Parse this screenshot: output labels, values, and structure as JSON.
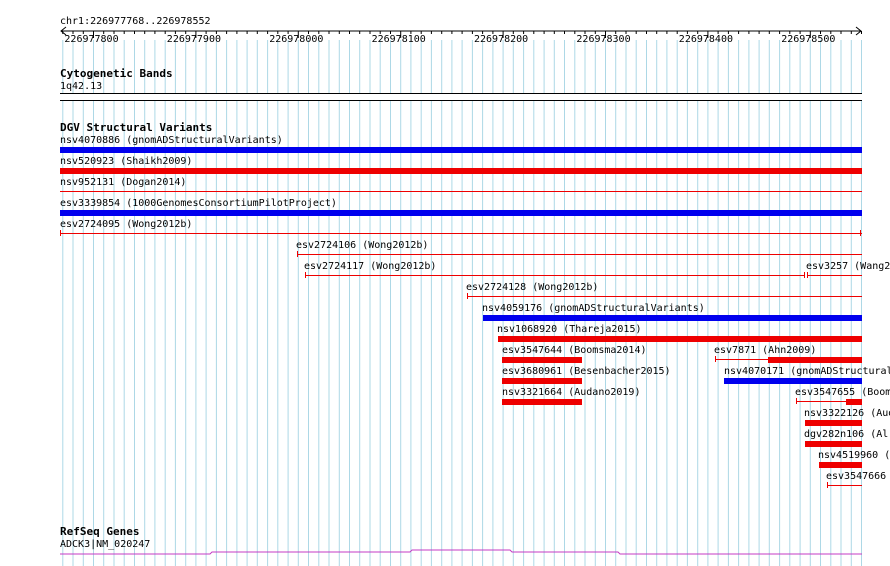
{
  "colors": {
    "grid": "#add8e6",
    "blue": "#0000ee",
    "red": "#ee0000",
    "gene": "#c43bc4",
    "text": "#000000"
  },
  "ruler": {
    "range_label": "chr1:226977768..226978552",
    "ticks": [
      "226977800",
      "226977900",
      "226978000",
      "226978100",
      "226978200",
      "226978300",
      "226978400",
      "226978500"
    ]
  },
  "cytoband": {
    "title": "Cytogenetic Bands",
    "band": "1q42.13"
  },
  "dgv": {
    "title": "DGV Structural Variants",
    "features": [
      {
        "id": "f1",
        "label": "nsv4070886 (gnomADStructuralVariants)",
        "color": "blue",
        "style": "thick"
      },
      {
        "id": "f2",
        "label": "nsv520923 (Shaikh2009)",
        "color": "red",
        "style": "thick"
      },
      {
        "id": "f3",
        "label": "nsv952131 (Dogan2014)",
        "color": "red",
        "style": "thin"
      },
      {
        "id": "f4",
        "label": "esv3339854 (1000GenomesConsortiumPilotProject)",
        "color": "blue",
        "style": "thick"
      },
      {
        "id": "f5",
        "label": "esv2724095 (Wong2012b)",
        "color": "red",
        "style": "thin"
      },
      {
        "id": "f6",
        "label": "esv2724106 (Wong2012b)",
        "color": "red",
        "style": "thin"
      },
      {
        "id": "f7",
        "label": "esv2724117 (Wong2012b)",
        "color": "red",
        "style": "thin"
      },
      {
        "id": "f8",
        "label": "esv3257 (Wang2",
        "color": "red",
        "style": "thin"
      },
      {
        "id": "f9",
        "label": "esv2724128 (Wong2012b)",
        "color": "red",
        "style": "thin"
      },
      {
        "id": "f10",
        "label": "nsv4059176 (gnomADStructuralVariants)",
        "color": "blue",
        "style": "thick"
      },
      {
        "id": "f11",
        "label": "nsv1068920 (Thareja2015)",
        "color": "red",
        "style": "thick"
      },
      {
        "id": "f12",
        "label": "esv3547644 (Boomsma2014)",
        "color": "red",
        "style": "thick"
      },
      {
        "id": "f13",
        "label": "esv7871 (Ahn2009)",
        "color": "red",
        "style": "thin"
      },
      {
        "id": "f14",
        "label": "esv3680961 (Besenbacher2015)",
        "color": "red",
        "style": "thick"
      },
      {
        "id": "f15",
        "label": "nsv4070171 (gnomADStructural",
        "color": "blue",
        "style": "thick"
      },
      {
        "id": "f16",
        "label": "nsv3321664 (Audano2019)",
        "color": "red",
        "style": "thick"
      },
      {
        "id": "f17",
        "label": "esv3547655 (Boom",
        "color": "red",
        "style": "thin"
      },
      {
        "id": "f18",
        "label": "nsv3322126 (Aud",
        "color": "red",
        "style": "thick"
      },
      {
        "id": "f19",
        "label": "dgv282n106 (Al",
        "color": "red",
        "style": "thick"
      },
      {
        "id": "f20",
        "label": "nsv4519960 (",
        "color": "red",
        "style": "thick"
      },
      {
        "id": "f21",
        "label": "esv3547666",
        "color": "red",
        "style": "thin"
      }
    ]
  },
  "refseq": {
    "title": "RefSeq Genes",
    "gene": "ADCK3|NM_020247"
  }
}
